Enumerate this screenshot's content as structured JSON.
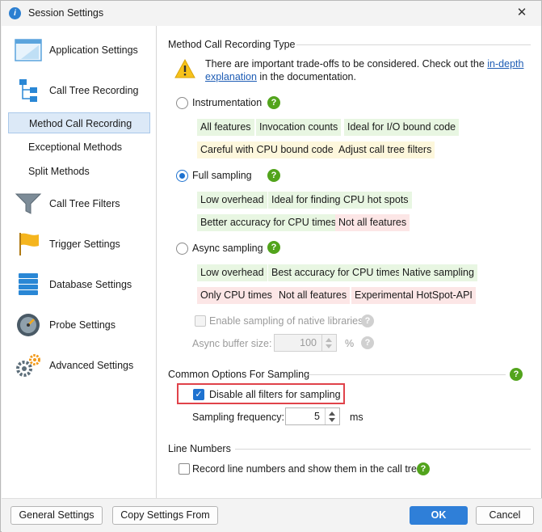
{
  "window": {
    "title": "Session Settings",
    "close_glyph": "✕"
  },
  "sidebar": {
    "items": [
      {
        "label": "Application Settings",
        "icon": "window-icon"
      },
      {
        "label": "Call Tree Recording",
        "icon": "tree-icon"
      },
      {
        "label": "Method Call Recording",
        "selected": true
      },
      {
        "label": "Exceptional Methods"
      },
      {
        "label": "Split Methods"
      },
      {
        "label": "Call Tree Filters",
        "icon": "funnel-icon"
      },
      {
        "label": "Trigger Settings",
        "icon": "flag-icon"
      },
      {
        "label": "Database Settings",
        "icon": "database-icon"
      },
      {
        "label": "Probe Settings",
        "icon": "gauge-icon"
      },
      {
        "label": "Advanced Settings",
        "icon": "gears-icon"
      }
    ]
  },
  "method_call": {
    "section_title": "Method Call Recording Type",
    "warning_before_link": "There are important trade-offs to be considered. Check out the ",
    "warning_link": "in-depth explanation",
    "warning_after_link": " in the documentation.",
    "options": [
      {
        "label": "Instrumentation",
        "selected": false,
        "tags_row1": [
          {
            "text": "All features",
            "kind": "green"
          },
          {
            "text": "Invocation counts",
            "kind": "green"
          },
          {
            "text": "Ideal for I/O bound code",
            "kind": "green"
          }
        ],
        "tags_row2": [
          {
            "text": "Careful with CPU bound code",
            "kind": "yellow"
          },
          {
            "text": "Adjust call tree filters",
            "kind": "yellow"
          }
        ]
      },
      {
        "label": "Full sampling",
        "selected": true,
        "tags_row1": [
          {
            "text": "Low overhead",
            "kind": "green"
          },
          {
            "text": "Ideal for finding CPU hot spots",
            "kind": "green"
          }
        ],
        "tags_row2": [
          {
            "text": "Better accuracy for CPU times",
            "kind": "green"
          },
          {
            "text": "Not all features",
            "kind": "red"
          }
        ]
      },
      {
        "label": "Async sampling",
        "selected": false,
        "tags_row1": [
          {
            "text": "Low overhead",
            "kind": "green"
          },
          {
            "text": "Best accuracy for CPU times",
            "kind": "green"
          },
          {
            "text": "Native sampling",
            "kind": "green"
          }
        ],
        "tags_row2": [
          {
            "text": "Only CPU times",
            "kind": "red"
          },
          {
            "text": "Not all features",
            "kind": "red"
          },
          {
            "text": "Experimental HotSpot-API",
            "kind": "red"
          }
        ]
      }
    ],
    "native_libs_label": "Enable sampling of native libraries",
    "async_buffer_label": "Async buffer size:",
    "async_buffer_value": "100",
    "async_buffer_unit": "%"
  },
  "common": {
    "section_title": "Common Options For Sampling",
    "disable_filters_label": "Disable all filters for sampling",
    "disable_filters_checked": true,
    "frequency_label": "Sampling frequency:",
    "frequency_value": "5",
    "frequency_unit": "ms"
  },
  "line_numbers": {
    "section_title": "Line Numbers",
    "record_label": "Record line numbers and show them in the call tree",
    "record_checked": false
  },
  "footer": {
    "general_settings": "General Settings",
    "copy_settings_from": "Copy Settings From",
    "ok": "OK",
    "cancel": "Cancel"
  },
  "colors": {
    "accent": "#2f7fd8",
    "help_green": "#52a41c",
    "tag_green": "#e8f6e2",
    "tag_yellow": "#fdf7dc",
    "tag_red": "#fce6e6",
    "highlight_red": "#e0424a"
  }
}
